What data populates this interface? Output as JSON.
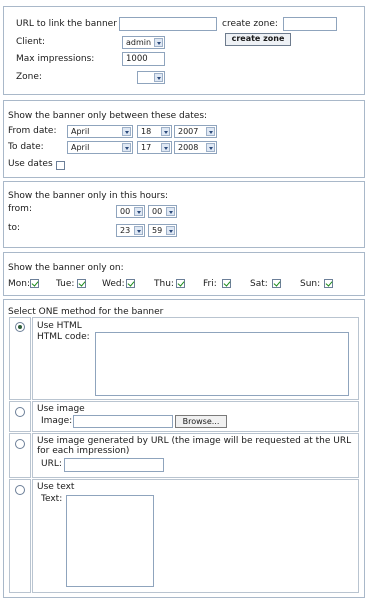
{
  "banner": {
    "url_label": "URL to link the banner",
    "url_value": "",
    "create_zone_label": "create zone:",
    "create_zone_value": "",
    "create_zone_button": "create zone",
    "client_label": "Client:",
    "client_value": "admin",
    "max_label": "Max impressions:",
    "max_value": "1000",
    "zone_label": "Zone:",
    "zone_value": ""
  },
  "dates": {
    "heading": "Show the banner only between these dates:",
    "from_label": "From date:",
    "from_month": "April",
    "from_day": "18",
    "from_year": "2007",
    "to_label": "To date:",
    "to_month": "April",
    "to_day": "17",
    "to_year": "2008",
    "use_dates_label": "Use dates",
    "use_dates_checked": false
  },
  "hours": {
    "heading": "Show the banner only in this hours:",
    "from_label": "from:",
    "from_hour": "00",
    "from_min": "00",
    "to_label": "to:",
    "to_hour": "23",
    "to_min": "59"
  },
  "days": {
    "heading": "Show the banner only on:",
    "items": [
      {
        "label": "Mon:",
        "checked": true
      },
      {
        "label": "Tue:",
        "checked": true
      },
      {
        "label": "Wed:",
        "checked": true
      },
      {
        "label": "Thu:",
        "checked": true
      },
      {
        "label": "Fri:",
        "checked": true
      },
      {
        "label": "Sat:",
        "checked": true
      },
      {
        "label": "Sun:",
        "checked": true
      }
    ]
  },
  "method": {
    "heading": "Select ONE method for the banner",
    "html": {
      "title": "Use HTML",
      "field_label": "HTML code:",
      "selected": true
    },
    "image": {
      "title": "Use image",
      "field_label": "Image:",
      "browse": "Browse..."
    },
    "url_image": {
      "title_line1": "Use image generated by URL (the image will be requested at the URL",
      "title_line2": "for each impression)",
      "field_label": "URL:"
    },
    "text": {
      "title": "Use text",
      "field_label": "Text:"
    }
  }
}
